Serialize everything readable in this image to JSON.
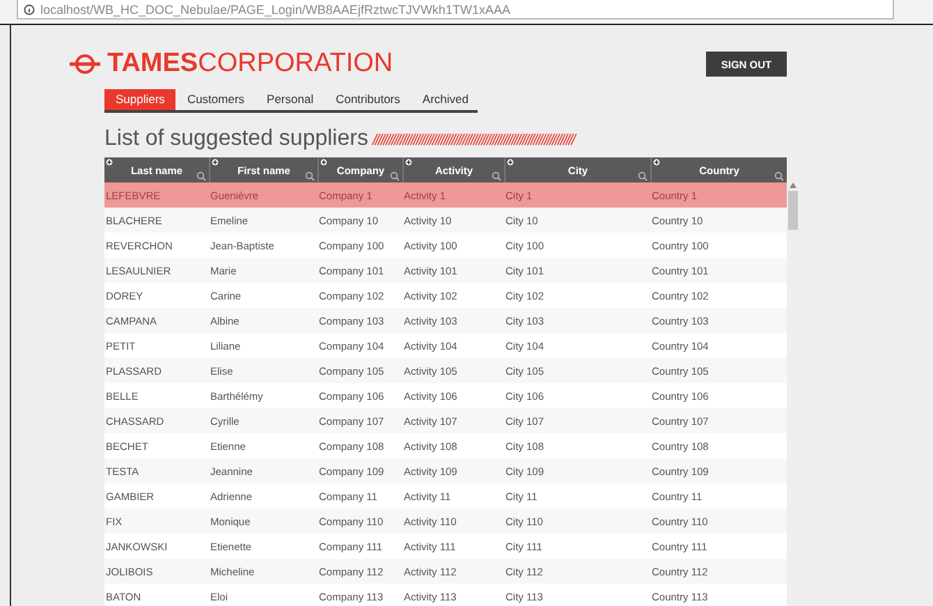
{
  "browser": {
    "url": "localhost/WB_HC_DOC_Nebulae/PAGE_Login/WB8AAEjfRztwcTJVWkh1TW1xAAA"
  },
  "header": {
    "logo_bold": "TAMES",
    "logo_light": "CORPORATION",
    "sign_out": "SIGN OUT"
  },
  "tabs": [
    {
      "label": "Suppliers",
      "selected": true
    },
    {
      "label": "Customers",
      "selected": false
    },
    {
      "label": "Personal",
      "selected": false
    },
    {
      "label": "Contributors",
      "selected": false
    },
    {
      "label": "Archived",
      "selected": false
    }
  ],
  "title": {
    "text": "List of suggested suppliers",
    "decoration": "//////////////////////////////////////////////////////////////////////////"
  },
  "table": {
    "columns": [
      "Last name",
      "First name",
      "Company",
      "Activity",
      "City",
      "Country"
    ],
    "rows": [
      {
        "cells": [
          "LEFEBVRE",
          "Guenièvre",
          "Company 1",
          "Activity 1",
          "City 1",
          "Country 1"
        ],
        "selected": true
      },
      {
        "cells": [
          "BLACHERE",
          "Emeline",
          "Company 10",
          "Activity 10",
          "City 10",
          "Country 10"
        ],
        "selected": false
      },
      {
        "cells": [
          "REVERCHON",
          "Jean-Baptiste",
          "Company 100",
          "Activity 100",
          "City 100",
          "Country 100"
        ],
        "selected": false
      },
      {
        "cells": [
          "LESAULNIER",
          "Marie",
          "Company 101",
          "Activity 101",
          "City 101",
          "Country 101"
        ],
        "selected": false
      },
      {
        "cells": [
          "DOREY",
          "Carine",
          "Company 102",
          "Activity 102",
          "City 102",
          "Country 102"
        ],
        "selected": false
      },
      {
        "cells": [
          "CAMPANA",
          "Albine",
          "Company 103",
          "Activity 103",
          "City 103",
          "Country 103"
        ],
        "selected": false
      },
      {
        "cells": [
          "PETIT",
          "Liliane",
          "Company 104",
          "Activity 104",
          "City 104",
          "Country 104"
        ],
        "selected": false
      },
      {
        "cells": [
          "PLASSARD",
          "Elise",
          "Company 105",
          "Activity 105",
          "City 105",
          "Country 105"
        ],
        "selected": false
      },
      {
        "cells": [
          "BELLE",
          "Barthélémy",
          "Company 106",
          "Activity 106",
          "City 106",
          "Country 106"
        ],
        "selected": false
      },
      {
        "cells": [
          "CHASSARD",
          "Cyrille",
          "Company 107",
          "Activity 107",
          "City 107",
          "Country 107"
        ],
        "selected": false
      },
      {
        "cells": [
          "BECHET",
          "Etienne",
          "Company 108",
          "Activity 108",
          "City 108",
          "Country 108"
        ],
        "selected": false
      },
      {
        "cells": [
          "TESTA",
          "Jeannine",
          "Company 109",
          "Activity 109",
          "City 109",
          "Country 109"
        ],
        "selected": false
      },
      {
        "cells": [
          "GAMBIER",
          "Adrienne",
          "Company 11",
          "Activity 11",
          "City 11",
          "Country 11"
        ],
        "selected": false
      },
      {
        "cells": [
          "FIX",
          "Monique",
          "Company 110",
          "Activity 110",
          "City 110",
          "Country 110"
        ],
        "selected": false
      },
      {
        "cells": [
          "JANKOWSKI",
          "Etienette",
          "Company 111",
          "Activity 111",
          "City 111",
          "Country 111"
        ],
        "selected": false
      },
      {
        "cells": [
          "JOLIBOIS",
          "Micheline",
          "Company 112",
          "Activity 112",
          "City 112",
          "Country 112"
        ],
        "selected": false
      },
      {
        "cells": [
          "BATON",
          "Eloi",
          "Company 113",
          "Activity 113",
          "City 113",
          "Country 113"
        ],
        "selected": false
      }
    ]
  }
}
